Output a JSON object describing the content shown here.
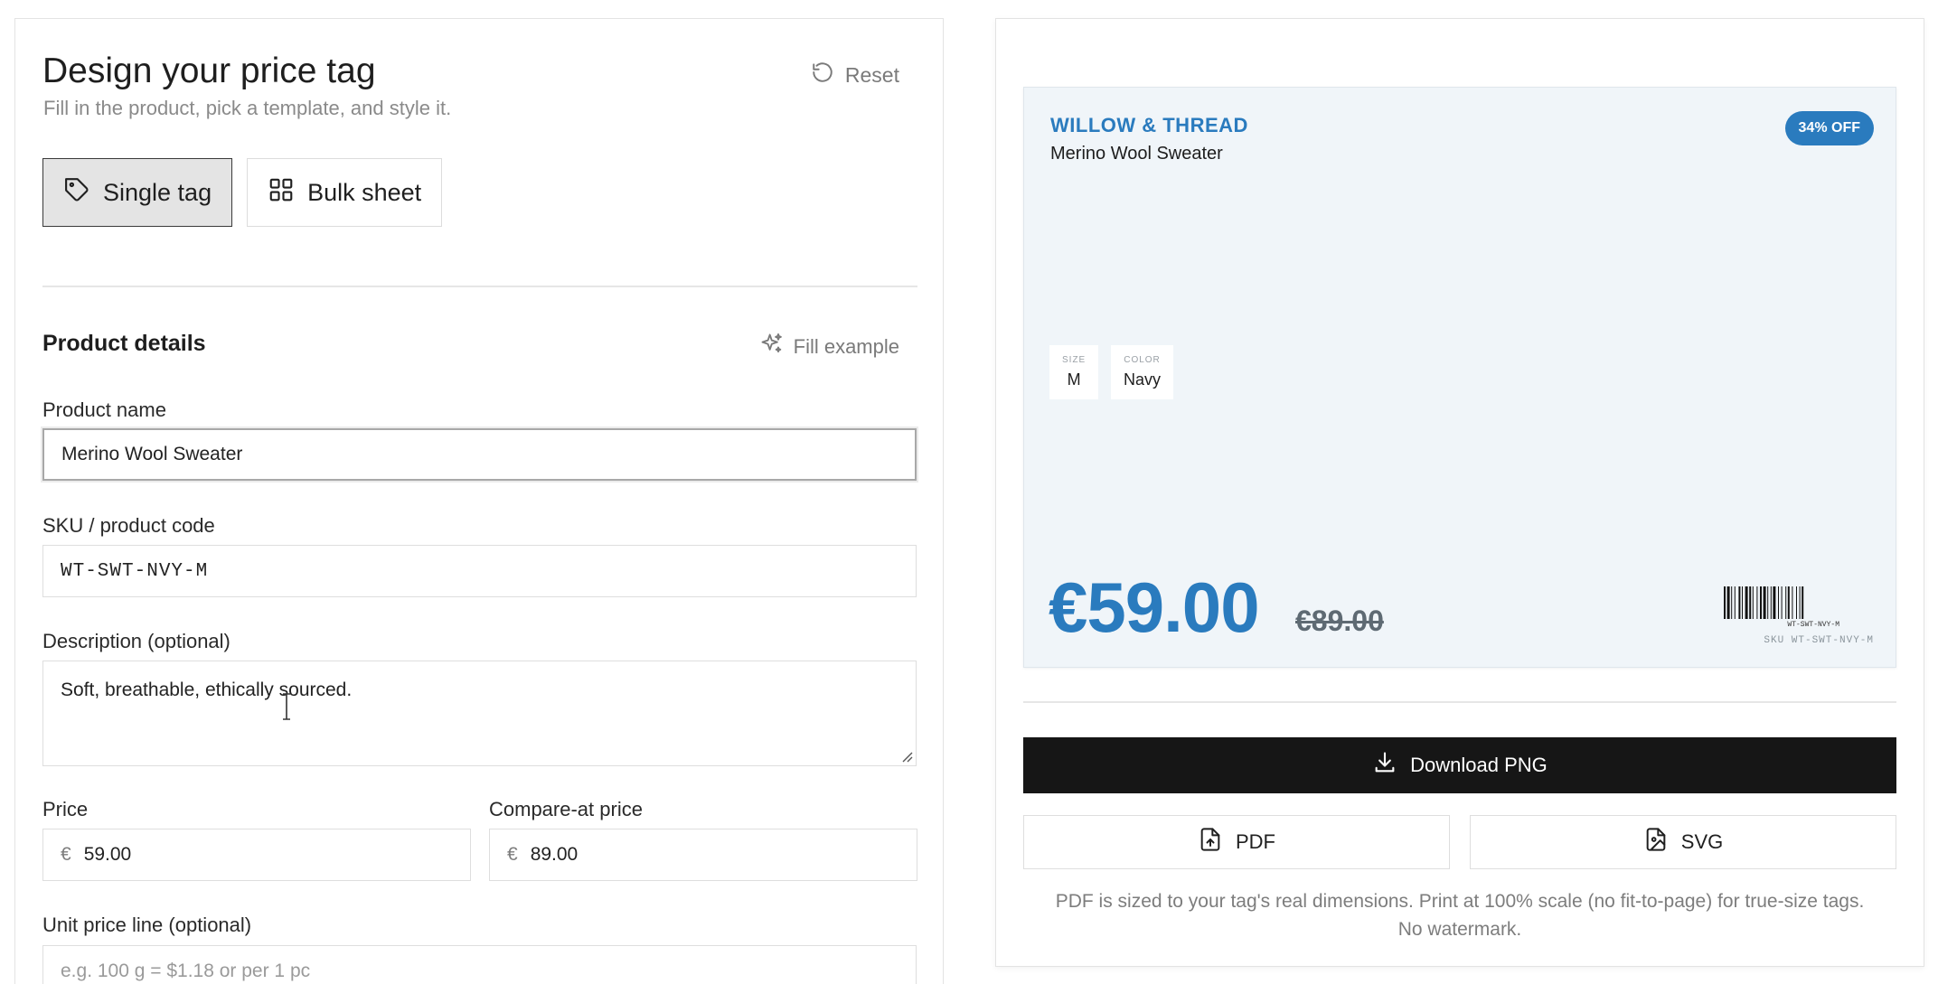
{
  "editor": {
    "title": "Design your price tag",
    "subtitle": "Fill in the product, pick a template, and style it.",
    "reset_label": "Reset",
    "modes": [
      {
        "label": "Single tag",
        "active": true
      },
      {
        "label": "Bulk sheet",
        "active": false
      }
    ],
    "section_title": "Product details",
    "fill_example_label": "Fill example",
    "fields": {
      "product_name": {
        "label": "Product name",
        "value": "Merino Wool Sweater"
      },
      "sku": {
        "label": "SKU / product code",
        "value": "WT-SWT-NVY-M"
      },
      "description": {
        "label": "Description (optional)",
        "value": "Soft, breathable, ethically sourced."
      },
      "price": {
        "label": "Price",
        "currency": "€",
        "value": "59.00"
      },
      "compare_price": {
        "label": "Compare-at price",
        "currency": "€",
        "value": "89.00"
      },
      "unit_price": {
        "label": "Unit price line (optional)",
        "placeholder": "e.g. 100 g = $1.18 or per 1 pc"
      }
    }
  },
  "preview": {
    "tag": {
      "brand": "WILLOW & THREAD",
      "product": "Merino Wool Sweater",
      "badge": "34% OFF",
      "attributes": [
        {
          "label": "SIZE",
          "value": "M"
        },
        {
          "label": "COLOR",
          "value": "Navy"
        }
      ],
      "price": "€59.00",
      "compare_price": "€89.00",
      "barcode_caption": "WT-SWT-NVY-M",
      "sku_line": "SKU WT-SWT-NVY-M",
      "accent_color": "#2a7bbe",
      "background_color": "#f0f5f9"
    },
    "download_png_label": "Download PNG",
    "pdf_label": "PDF",
    "svg_label": "SVG",
    "export_note_line1": "PDF is sized to your tag's real dimensions. Print at 100% scale (no fit-to-page) for true-size tags.",
    "export_note_line2": "No watermark."
  },
  "icons": {
    "reset": "rotate-ccw-icon",
    "single_tag": "tag-icon",
    "bulk_sheet": "grid-icon",
    "fill_example": "sparkles-icon",
    "download": "download-icon",
    "pdf": "file-text-icon",
    "svg": "file-image-icon"
  }
}
